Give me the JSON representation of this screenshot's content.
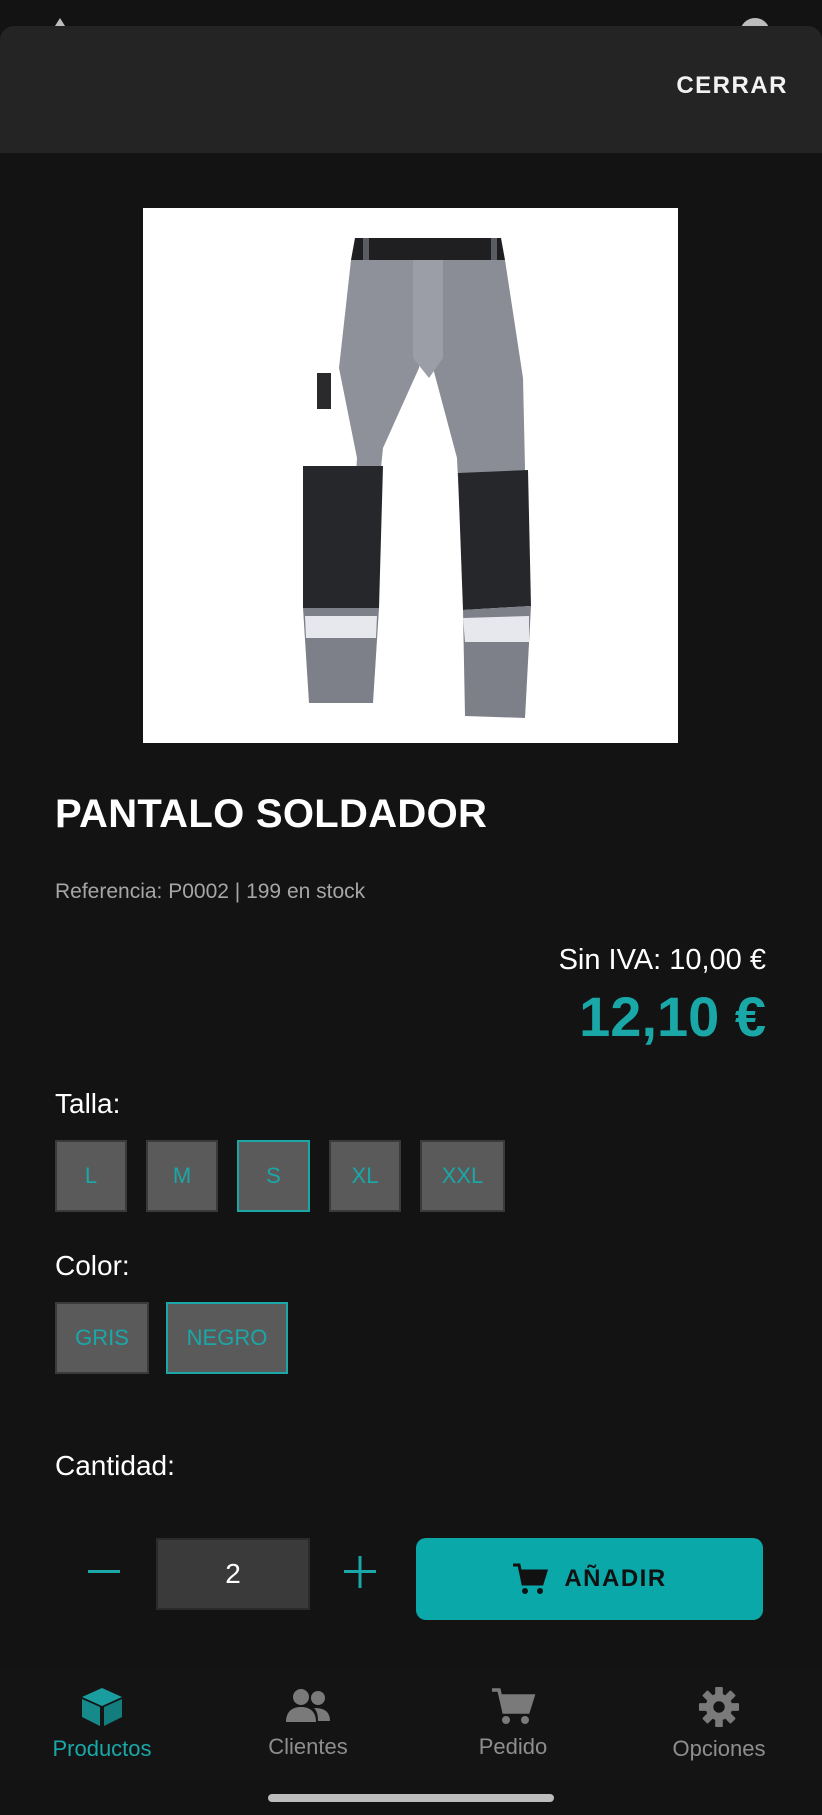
{
  "header": {
    "close_label": "CERRAR"
  },
  "product": {
    "title": "PANTALO SOLDADOR",
    "meta": "Referencia: P0002 | 199 en stock",
    "price_net": "Sin IVA: 10,00 €",
    "price_gross": "12,10 €"
  },
  "size": {
    "label": "Talla:",
    "options": [
      "L",
      "M",
      "S",
      "XL",
      "XXL"
    ],
    "selected": "S"
  },
  "color": {
    "label": "Color:",
    "options": [
      "GRIS",
      "NEGRO"
    ],
    "selected": "NEGRO"
  },
  "quantity": {
    "label": "Cantidad:",
    "value": "2"
  },
  "actions": {
    "add_label": "AÑADIR"
  },
  "bottom_nav": {
    "items": [
      {
        "label": "Productos",
        "icon": "box-icon",
        "active": true
      },
      {
        "label": "Clientes",
        "icon": "users-icon",
        "active": false
      },
      {
        "label": "Pedido",
        "icon": "cart-icon",
        "active": false
      },
      {
        "label": "Opciones",
        "icon": "gear-icon",
        "active": false
      }
    ]
  },
  "colors": {
    "accent": "#1aa7a8",
    "background": "#131313",
    "surface": "#242424",
    "chip": "#5a5a5a"
  }
}
